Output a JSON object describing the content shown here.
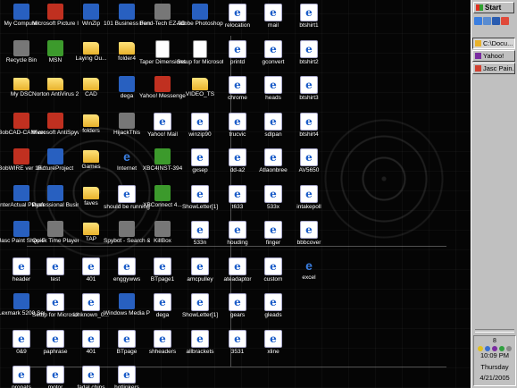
{
  "desktop": {
    "columns": [
      [
        {
          "label": "My Computer",
          "icon": "computer-icon",
          "style": "app"
        },
        {
          "label": "Recycle Bin",
          "icon": "recycle-bin-icon",
          "style": "gray"
        },
        {
          "label": "My DSC",
          "icon": "folder-icon",
          "style": "folder"
        },
        {
          "label": "BobCAD-CAM ver. 17 ME",
          "icon": "bobcad-icon",
          "style": "red"
        },
        {
          "label": "BobWIRE ver 15.1 for Wir...",
          "icon": "bobwire-icon",
          "style": "red"
        },
        {
          "label": "InterActual Player",
          "icon": "interactual-icon",
          "style": "app"
        },
        {
          "label": "Jasc Paint Shop Pro 9",
          "icon": "paintshop-icon",
          "style": "app"
        },
        {
          "label": "header",
          "icon": "web-page-icon",
          "style": "html"
        },
        {
          "label": "Lexmark 5200 Series All-in...",
          "icon": "lexmark-icon",
          "style": "app"
        },
        {
          "label": "0&9",
          "icon": "web-page-icon",
          "style": "html"
        },
        {
          "label": "propats",
          "icon": "web-page-icon",
          "style": "html"
        }
      ],
      [
        {
          "label": "Microsoft Picture It!",
          "icon": "picture-it-icon",
          "style": "red"
        },
        {
          "label": "MSN",
          "icon": "msn-icon",
          "style": "green"
        },
        {
          "label": "Norton AntiVirus 2005",
          "icon": "norton-icon",
          "style": "folder"
        },
        {
          "label": "Microsoft AntiSpyware",
          "icon": "antispyware-icon",
          "style": "red"
        },
        {
          "label": "PictureProject",
          "icon": "picture-project-icon",
          "style": "app"
        },
        {
          "label": "Professional Business Labels",
          "icon": "labels-icon",
          "style": "app"
        },
        {
          "label": "Quick Time Player",
          "icon": "quicktime-icon",
          "style": "gray"
        },
        {
          "label": "test",
          "icon": "web-page-icon",
          "style": "html"
        },
        {
          "label": "Setup for Microsoft I...",
          "icon": "setup-icon",
          "style": "html"
        },
        {
          "label": "paphrase",
          "icon": "web-page-icon",
          "style": "html"
        },
        {
          "label": "motor",
          "icon": "web-page-icon",
          "style": "html"
        }
      ],
      [
        {
          "label": "WinZip",
          "icon": "winzip-icon",
          "style": "app"
        },
        {
          "label": "Laying Ou...",
          "icon": "folder-icon",
          "style": "folder"
        },
        {
          "label": "CAD",
          "icon": "folder-icon",
          "style": "folder"
        },
        {
          "label": "folders",
          "icon": "folder-icon",
          "style": "folder"
        },
        {
          "label": "Games",
          "icon": "folder-icon",
          "style": "folder"
        },
        {
          "label": "faves",
          "icon": "folder-icon",
          "style": "folder"
        },
        {
          "label": "TAP",
          "icon": "folder-icon",
          "style": "folder"
        },
        {
          "label": "401",
          "icon": "web-page-icon",
          "style": "html"
        },
        {
          "label": "Unknown_0...",
          "icon": "web-page-icon",
          "style": "html"
        },
        {
          "label": "401",
          "icon": "web-page-icon",
          "style": "html"
        },
        {
          "label": "fadal chips",
          "icon": "web-page-icon",
          "style": "html"
        }
      ],
      [
        {
          "label": "101 Business Forms Setup",
          "icon": "forms-icon",
          "style": "app"
        },
        {
          "label": "folder4",
          "icon": "folder-icon",
          "style": "folder"
        },
        {
          "label": "dega",
          "icon": "dega-icon",
          "style": "app"
        },
        {
          "label": "HijackThis",
          "icon": "hijackthis-icon",
          "style": "gray"
        },
        {
          "label": "Internet",
          "icon": "internet-icon",
          "style": "ie"
        },
        {
          "label": "should be running",
          "icon": "web-page-icon",
          "style": "html"
        },
        {
          "label": "Spybot - Search & Destroy",
          "icon": "spybot-icon",
          "style": "gray"
        },
        {
          "label": "enggywws",
          "icon": "web-page-icon",
          "style": "html"
        },
        {
          "label": "Windows Media Player",
          "icon": "media-player-icon",
          "style": "app"
        },
        {
          "label": "BTpage",
          "icon": "web-page-icon",
          "style": "html"
        },
        {
          "label": "hotlinkers",
          "icon": "web-page-icon",
          "style": "html"
        }
      ],
      [
        {
          "label": "Bend-Tech EZ-3D",
          "icon": "bendtech-icon",
          "style": "gray"
        },
        {
          "label": "Taper Dimensions",
          "icon": "taper-icon",
          "style": "doc"
        },
        {
          "label": "Yahoo! Messenger",
          "icon": "yahoo-messenger-icon",
          "style": "red"
        },
        {
          "label": "Yahoo! Mail",
          "icon": "web-page-icon",
          "style": "html"
        },
        {
          "label": "XBC4INST-394",
          "icon": "xbc-icon",
          "style": "green"
        },
        {
          "label": "XBConnect 4...",
          "icon": "xbconnect-icon",
          "style": "green"
        },
        {
          "label": "KillBox",
          "icon": "killbox-icon",
          "style": "gray"
        },
        {
          "label": "BTpage1",
          "icon": "web-page-icon",
          "style": "html"
        },
        {
          "label": "dega",
          "icon": "web-page-icon",
          "style": "html"
        },
        {
          "label": "shheaders",
          "icon": "web-page-icon",
          "style": "html"
        }
      ],
      [
        {
          "label": "Adobe Photoshop ...",
          "icon": "photoshop-icon",
          "style": "app"
        },
        {
          "label": "Setup for Microsoft W...",
          "icon": "setup-icon",
          "style": "doc"
        },
        {
          "label": "VIDEO_TS",
          "icon": "folder-icon",
          "style": "folder"
        },
        {
          "label": "winzip90",
          "icon": "web-page-icon",
          "style": "html"
        },
        {
          "label": "gxsep",
          "icon": "web-page-icon",
          "style": "html"
        },
        {
          "label": "ShowLetter[1]",
          "icon": "web-page-icon",
          "style": "html"
        },
        {
          "label": "533n",
          "icon": "web-page-icon",
          "style": "html"
        },
        {
          "label": "amcpulley",
          "icon": "web-page-icon",
          "style": "html"
        },
        {
          "label": "ShowLetter[1]",
          "icon": "web-page-icon",
          "style": "html"
        },
        {
          "label": "allbrackets",
          "icon": "web-page-icon",
          "style": "html"
        }
      ],
      [
        {
          "label": "relocation",
          "icon": "web-page-icon",
          "style": "html"
        },
        {
          "label": "printd",
          "icon": "web-page-icon",
          "style": "html"
        },
        {
          "label": "chrome",
          "icon": "web-page-icon",
          "style": "html"
        },
        {
          "label": "trucvic",
          "icon": "web-page-icon",
          "style": "html"
        },
        {
          "label": "dd-a2",
          "icon": "web-page-icon",
          "style": "html"
        },
        {
          "label": "t633",
          "icon": "web-page-icon",
          "style": "html"
        },
        {
          "label": "houding",
          "icon": "web-page-icon",
          "style": "html"
        },
        {
          "label": "ateadaptor",
          "icon": "web-page-icon",
          "style": "html"
        },
        {
          "label": "gears",
          "icon": "web-page-icon",
          "style": "html"
        },
        {
          "label": "3531",
          "icon": "web-page-icon",
          "style": "html"
        }
      ],
      [
        {
          "label": "mail",
          "icon": "web-page-icon",
          "style": "html"
        },
        {
          "label": "gconvert",
          "icon": "web-page-icon",
          "style": "html"
        },
        {
          "label": "heads",
          "icon": "web-page-icon",
          "style": "html"
        },
        {
          "label": "sdlpan",
          "icon": "web-page-icon",
          "style": "html"
        },
        {
          "label": "Atlaonbree",
          "icon": "web-page-icon",
          "style": "html"
        },
        {
          "label": "533x",
          "icon": "web-page-icon",
          "style": "html"
        },
        {
          "label": "finger",
          "icon": "web-page-icon",
          "style": "html"
        },
        {
          "label": "custom",
          "icon": "web-page-icon",
          "style": "html"
        },
        {
          "label": "gleads",
          "icon": "web-page-icon",
          "style": "html"
        },
        {
          "label": "xline",
          "icon": "web-page-icon",
          "style": "html"
        }
      ],
      [
        {
          "label": "btshirt1",
          "icon": "web-page-icon",
          "style": "html"
        },
        {
          "label": "btshirt2",
          "icon": "web-page-icon",
          "style": "html"
        },
        {
          "label": "btshirt3",
          "icon": "web-page-icon",
          "style": "html"
        },
        {
          "label": "btshirt4",
          "icon": "web-page-icon",
          "style": "html"
        },
        {
          "label": "AV5650",
          "icon": "web-page-icon",
          "style": "html"
        },
        {
          "label": "intakepoll",
          "icon": "web-page-icon",
          "style": "html"
        },
        {
          "label": "bbbcover",
          "icon": "web-page-icon",
          "style": "html"
        },
        {
          "label": "excel",
          "icon": "web-page-icon",
          "style": "ie"
        }
      ]
    ]
  },
  "taskbar": {
    "start_label": "Start",
    "tasks": [
      {
        "label": "C:\\Docu...",
        "active": true
      },
      {
        "label": "Yahoo!",
        "active": false
      },
      {
        "label": "Jasc Pain...",
        "active": false
      }
    ],
    "tray_count": "8",
    "time": "10:09 PM",
    "day": "Thursday",
    "date": "4/21/2005"
  }
}
